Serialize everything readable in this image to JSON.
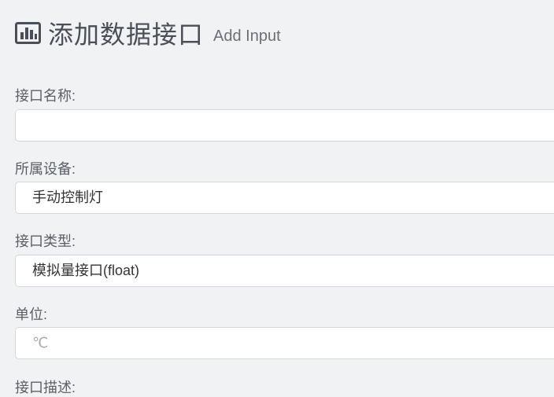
{
  "header": {
    "icon": "bar-chart-icon",
    "title": "添加数据接口",
    "subtitle": "Add Input"
  },
  "form": {
    "name": {
      "label": "接口名称:",
      "value": "",
      "placeholder": ""
    },
    "device": {
      "label": "所属设备:",
      "selected": "手动控制灯"
    },
    "type": {
      "label": "接口类型:",
      "selected": "模拟量接口(float)"
    },
    "unit": {
      "label": "单位:",
      "placeholder": "℃"
    },
    "description": {
      "label": "接口描述:"
    }
  },
  "colors": {
    "background": "#f1f2f4",
    "border": "#d3d6da",
    "title": "#4a4f57",
    "icon": "#4a4f57"
  }
}
